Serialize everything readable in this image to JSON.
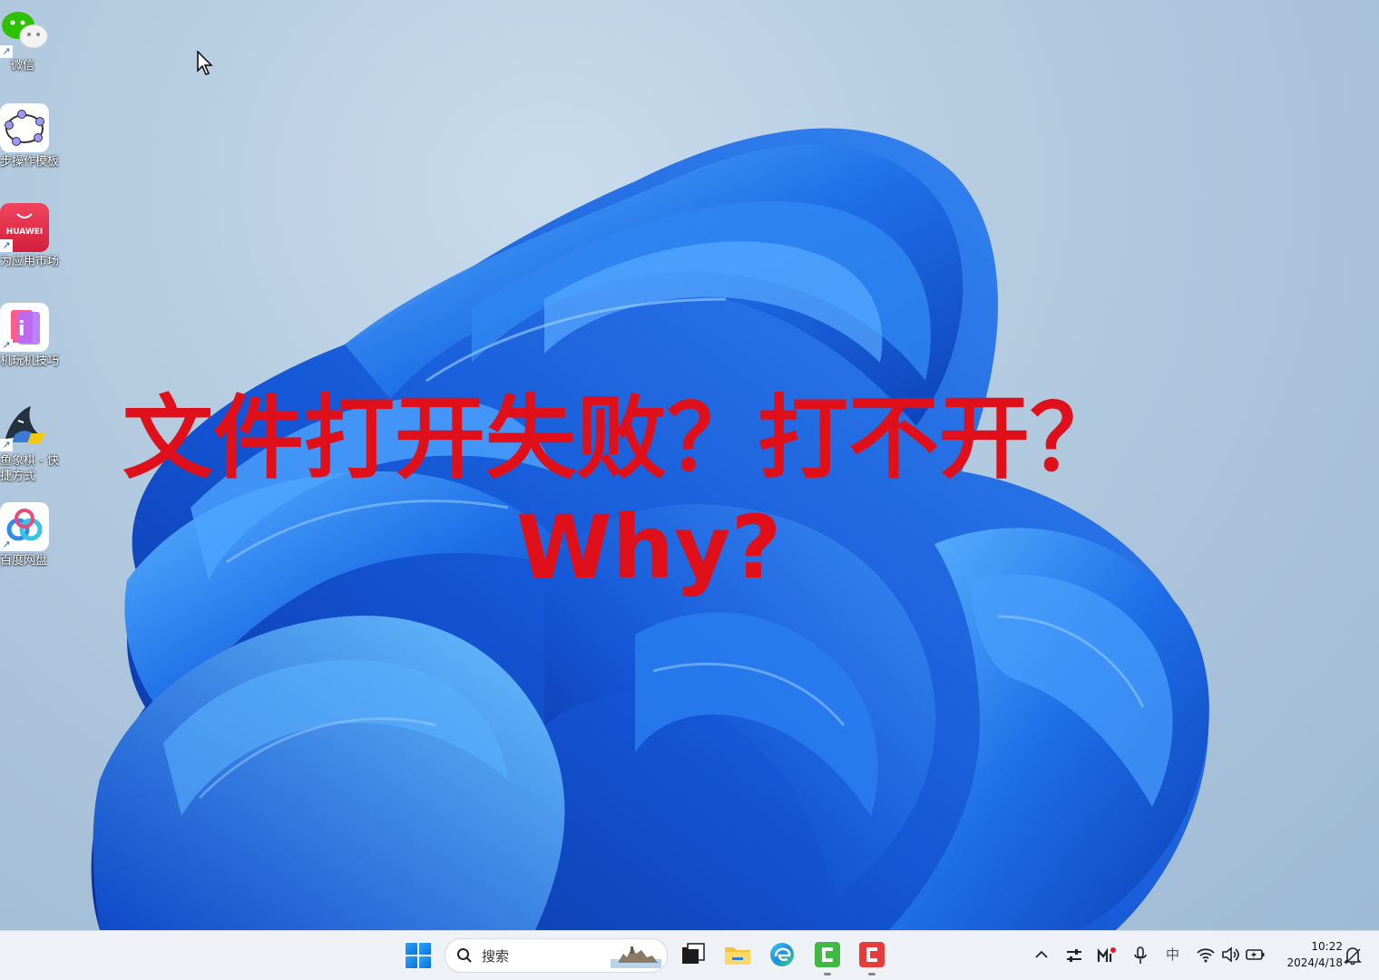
{
  "desktop_icons": [
    {
      "label": "微信",
      "icon": "wechat-icon"
    },
    {
      "label": "步操作模板",
      "icon": "geogebra-icon"
    },
    {
      "label": "为应用市场",
      "icon": "huawei-appgallery-icon",
      "brand_text": "HUAWEI"
    },
    {
      "label": "机玩机技巧",
      "icon": "tips-app-icon"
    },
    {
      "label": "鱼象棋 - 快捷方式",
      "icon": "shark-chess-icon"
    },
    {
      "label": "百度网盘",
      "icon": "baidu-netdisk-icon"
    }
  ],
  "overlay": {
    "line1": "文件打开失败？打不开？",
    "line2": "Why?",
    "color": "#e0101a"
  },
  "taskbar": {
    "search_placeholder": "搜索",
    "apps": [
      "start-icon",
      "task-view-icon",
      "file-explorer-icon",
      "edge-icon",
      "camtasia-green-icon",
      "camtasia-red-icon"
    ],
    "tray_ime": "中",
    "time": "10:22",
    "date": "2024/4/18"
  }
}
